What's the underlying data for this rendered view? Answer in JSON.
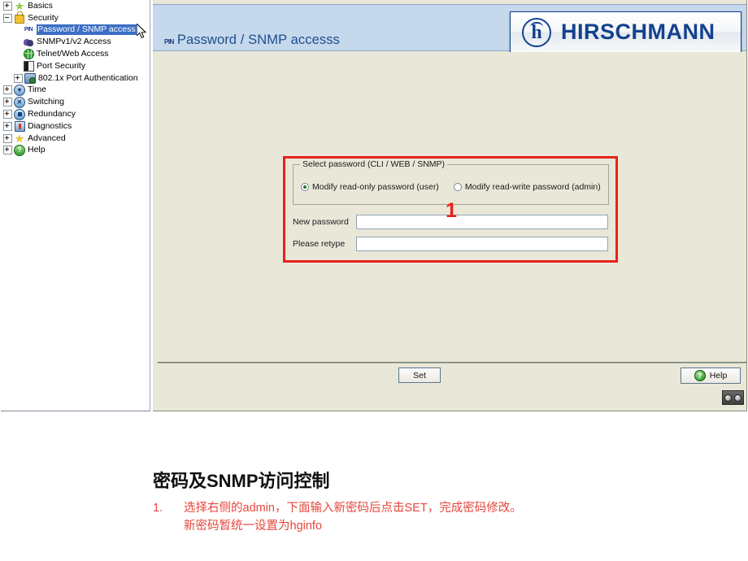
{
  "nav_tree": {
    "items": [
      {
        "label": "Basics",
        "icon": "star-green-icon",
        "toggle": "plus",
        "indent": 0,
        "selected": false
      },
      {
        "label": "Security",
        "icon": "padlock-icon",
        "toggle": "minus",
        "indent": 0,
        "selected": false
      },
      {
        "label": "Password / SNMP access",
        "icon": "pin-icon",
        "toggle": "none",
        "indent": 1,
        "selected": true
      },
      {
        "label": "SNMPv1/v2 Access",
        "icon": "masks-icon",
        "toggle": "none",
        "indent": 1,
        "selected": false
      },
      {
        "label": "Telnet/Web Access",
        "icon": "globe-icon",
        "toggle": "none",
        "indent": 1,
        "selected": false
      },
      {
        "label": "Port Security",
        "icon": "port-security-icon",
        "toggle": "none",
        "indent": 1,
        "selected": false
      },
      {
        "label": "802.1x Port Authentication",
        "icon": "network-auth-icon",
        "toggle": "plus",
        "indent": 1,
        "selected": false
      },
      {
        "label": "Time",
        "icon": "clock-icon",
        "toggle": "plus",
        "indent": 0,
        "selected": false
      },
      {
        "label": "Switching",
        "icon": "switching-icon",
        "toggle": "plus",
        "indent": 0,
        "selected": false
      },
      {
        "label": "Redundancy",
        "icon": "redundancy-icon",
        "toggle": "plus",
        "indent": 0,
        "selected": false
      },
      {
        "label": "Diagnostics",
        "icon": "diagnostics-icon",
        "toggle": "plus",
        "indent": 0,
        "selected": false
      },
      {
        "label": "Advanced",
        "icon": "star-gold-icon",
        "toggle": "plus",
        "indent": 0,
        "selected": false
      },
      {
        "label": "Help",
        "icon": "help-green-icon",
        "toggle": "plus",
        "indent": 0,
        "selected": false
      }
    ]
  },
  "device_page": {
    "title": "Password / SNMP accesss",
    "title_icon_text": "PIN",
    "brand": {
      "mark_letter": "h",
      "name": "HIRSCHMANN"
    },
    "form": {
      "fieldset_legend": "Select password  (CLI / WEB / SNMP)",
      "radios": [
        {
          "label": "Modify read-only password (user)",
          "checked": true
        },
        {
          "label": "Modify read-write password (admin)",
          "checked": false
        }
      ],
      "new_password": {
        "label": "New password",
        "value": "",
        "placeholder": ""
      },
      "retype_password": {
        "label": "Please retype",
        "value": "",
        "placeholder": ""
      }
    },
    "footer": {
      "set_label": "Set",
      "help_label": "Help",
      "help_icon_text": "?"
    }
  },
  "annotation": {
    "number": "1",
    "box_color": "#e8221a"
  },
  "caption": {
    "title": "密码及SNMP访问控制",
    "marker": "1.",
    "lines": [
      "选择右侧的admin，下面输入新密码后点击SET，完成密码修改。",
      "新密码暂统一设置为hginfo"
    ],
    "color": "#e8463c"
  }
}
